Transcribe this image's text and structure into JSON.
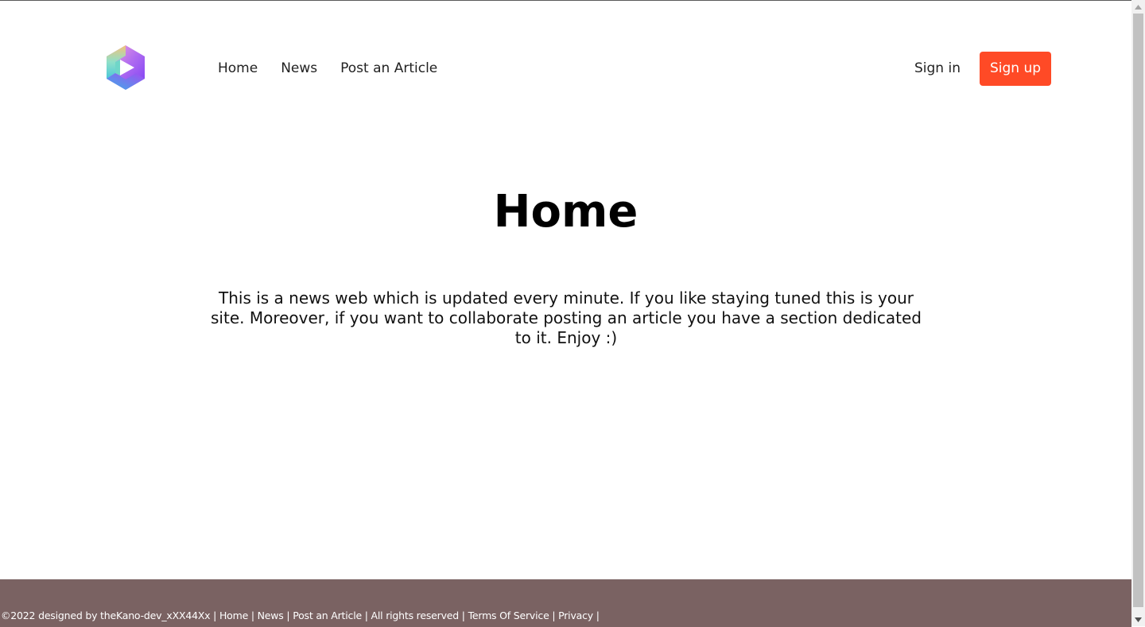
{
  "nav": {
    "logo_icon": "hexagon-play-logo-icon",
    "links": [
      "Home",
      "News",
      "Post an Article"
    ],
    "sign_in": "Sign in",
    "sign_up": "Sign up",
    "accent_color": "#ff4a26"
  },
  "main": {
    "title": "Home",
    "description": "This is a news web which is updated every minute. If you like staying tuned this is your site. Moreover, if you want to collaborate posting an article you have a section dedicated to it. Enjoy :)"
  },
  "footer": {
    "background_color": "#7a6262",
    "copyright": "©2022 designed by theKano-dev_xXX44Xx",
    "separator": " | ",
    "links": [
      "Home",
      "News",
      "Post an Article"
    ],
    "rights": "All rights reserved",
    "terms": "Terms Of Service",
    "privacy": "Privacy",
    "trailing": " |"
  }
}
